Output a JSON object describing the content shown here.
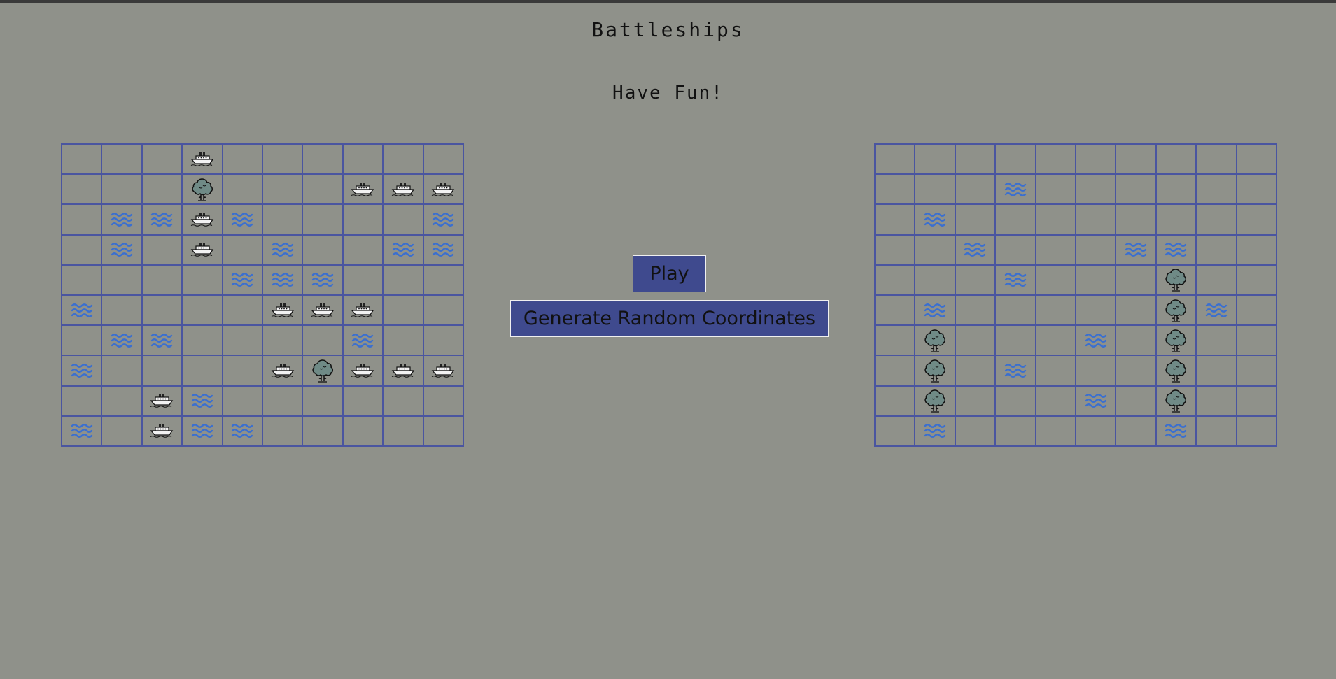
{
  "title": "Battleships",
  "subtitle": "Have Fun!",
  "buttons": {
    "play": "Play",
    "generate": "Generate Random Coordinates"
  },
  "legend": {
    "S": "ship-icon",
    "W": "water-icon",
    "T": "tree-icon",
    ".": "empty"
  },
  "colors": {
    "background": "#8f918a",
    "grid": "#4a55a0",
    "button": "#3f4a8e",
    "water": "#3a6fd0",
    "tree": "#6f8a86"
  },
  "boards": {
    "player": [
      "...S......",
      "...T...SSS",
      ".WWSW....W",
      ".W.S.W..WW",
      "....WWW...",
      "W....SSS..",
      ".WW....W..",
      "W....STSSS",
      "..SW......",
      "W.SWW....."
    ],
    "opponent": [
      "..........",
      "...W......",
      ".W........",
      "..W...WW..",
      "...W...T..",
      ".W.....TW.",
      ".T...W.T..",
      ".T.W...T..",
      ".T...W.T..",
      ".W.....W.."
    ]
  }
}
